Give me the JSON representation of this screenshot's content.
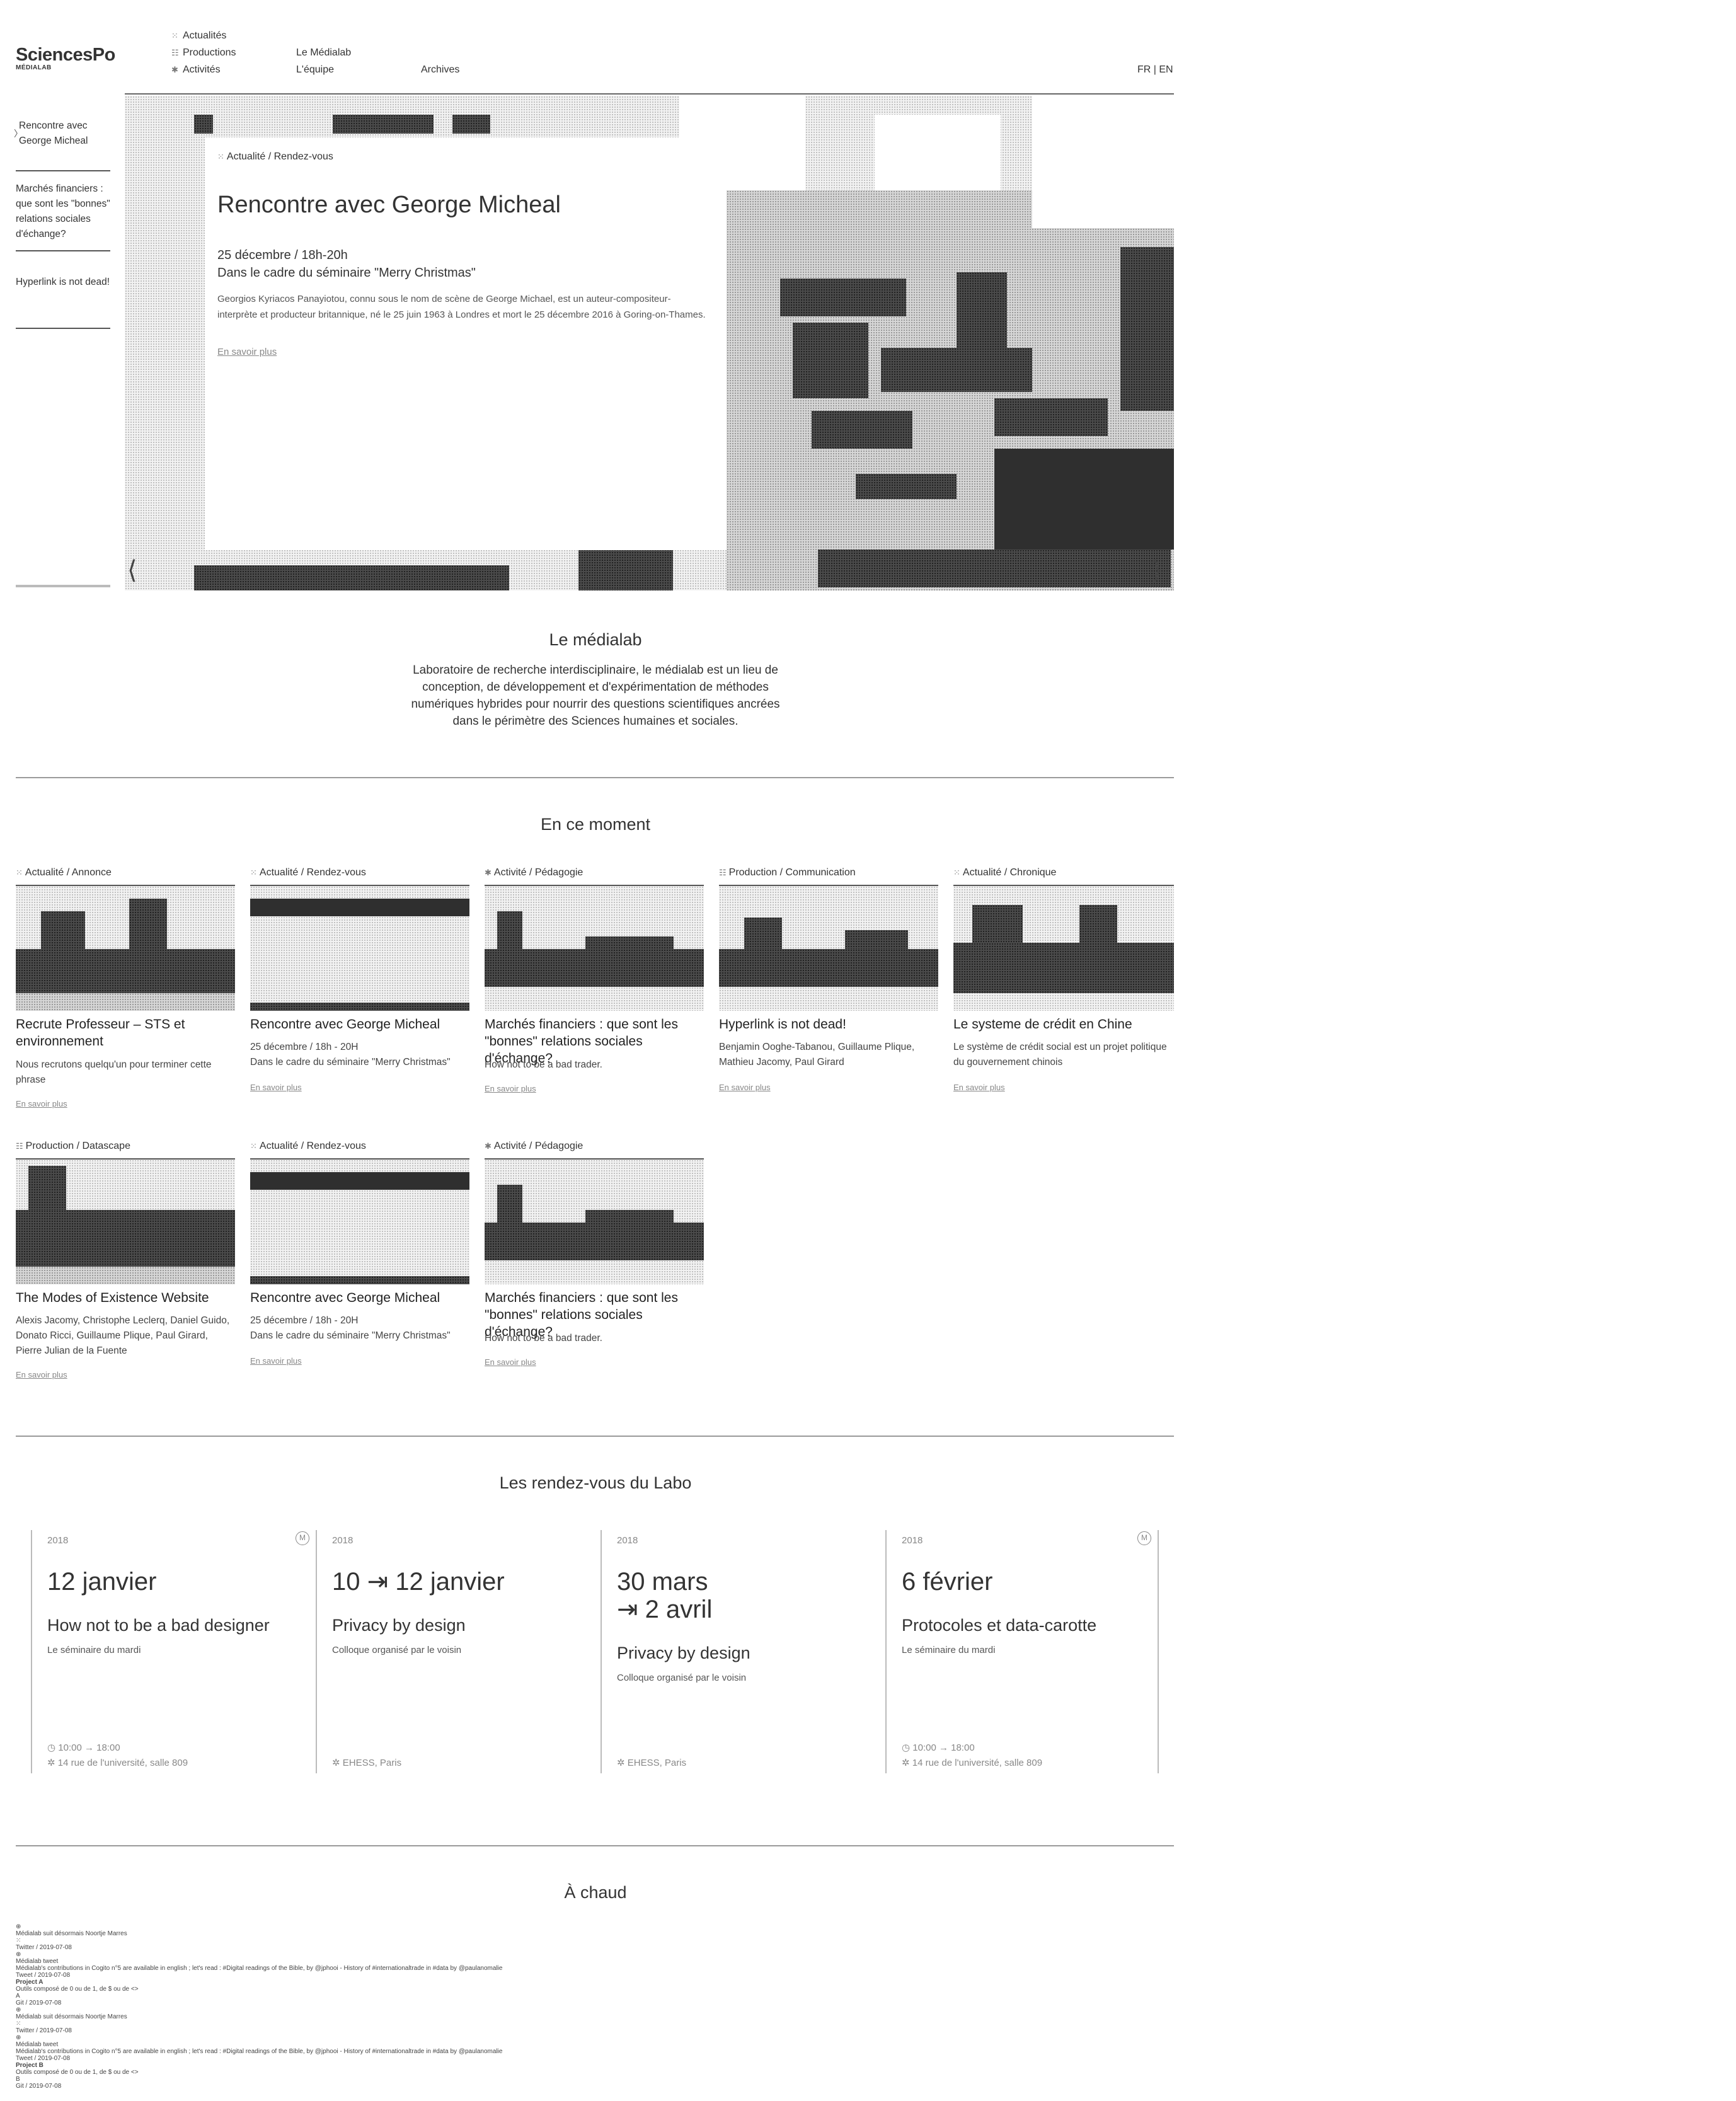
{
  "header": {
    "logo_name": "SciencesPo",
    "logo_sub": "MÉDIALAB",
    "nav": {
      "actualites": "Actualités",
      "productions": "Productions",
      "activites": "Activités",
      "medialab": "Le Médialab",
      "equipe": "L'équipe",
      "archives": "Archives"
    },
    "lang": "FR | EN"
  },
  "sidebar": {
    "items": [
      "Rencontre avec George Micheal",
      "Marchés financiers : que sont les \"bonnes\" relations sociales d'échange?",
      "Hyperlink is not dead!"
    ]
  },
  "hero": {
    "category": "Actualité / Rendez-vous",
    "title": "Rencontre avec George Micheal",
    "date": "25 décembre / 18h-20h",
    "context": "Dans le cadre du séminaire \"Merry Christmas\"",
    "description": "Georgios Kyriacos Panayiotou, connu sous le nom de scène de George Michael, est un auteur-compositeur-interprète et producteur britannique, né le 25 juin 1963 à Londres et mort le 25 décembre 2016 à Goring-on-Thames.",
    "more": "En savoir plus",
    "prev": "⟨",
    "next": "⟩"
  },
  "about": {
    "title": "Le médialab",
    "text": "Laboratoire de recherche interdisciplinaire, le médialab est un lieu de conception, de développement et d'expérimentation de méthodes numériques hybrides pour nourrir des questions scientifiques ancrées dans le périmètre des Sciences humaines et sociales."
  },
  "now": {
    "title": "En ce moment",
    "cards": [
      {
        "icon": "⁙",
        "tag": "Actualité / Annonce",
        "title": "Recrute Professeur – STS et environnement",
        "text": "Nous recrutons quelqu'un pour terminer cette phrase",
        "more": "En savoir plus"
      },
      {
        "icon": "⁙",
        "tag": "Actualité / Rendez-vous",
        "title": "Rencontre avec George Micheal",
        "text": "25 décembre / 18h - 20H\nDans le cadre du séminaire \"Merry Christmas\"",
        "more": "En savoir plus"
      },
      {
        "icon": "✱",
        "tag": "Activité / Pédagogie",
        "title": "Marchés financiers : que sont les \"bonnes\" relations sociales d'échange?",
        "text": "How not to be a bad trader.",
        "more": "En savoir plus"
      },
      {
        "icon": "☷",
        "tag": "Production / Communication",
        "title": "Hyperlink is not dead!",
        "text": "Benjamin Ooghe-Tabanou, Guillaume Plique, Mathieu Jacomy, Paul Girard",
        "more": "En savoir plus"
      },
      {
        "icon": "⁙",
        "tag": "Actualité / Chronique",
        "title": "Le systeme de crédit en Chine",
        "text": "Le système de crédit social est un projet politique du gouvernement chinois",
        "more": "En savoir plus"
      },
      {
        "icon": "☷",
        "tag": "Production / Datascape",
        "title": "The Modes of Existence Website",
        "text": "Alexis Jacomy, Christophe Leclerq, Daniel Guido, Donato Ricci, Guillaume Plique, Paul Girard, Pierre Julian de la Fuente",
        "more": "En savoir plus"
      },
      {
        "icon": "⁙",
        "tag": "Actualité / Rendez-vous",
        "title": "Rencontre avec George Micheal",
        "text": "25 décembre / 18h - 20H\nDans le cadre du séminaire \"Merry Christmas\"",
        "more": "En savoir plus"
      },
      {
        "icon": "✱",
        "tag": "Activité / Pédagogie",
        "title": "Marchés financiers : que sont les \"bonnes\" relations sociales d'échange?",
        "text": "How not to be a bad trader.",
        "more": "En savoir plus"
      }
    ]
  },
  "rdv": {
    "title": "Les rendez-vous du Labo",
    "items": [
      {
        "year": "2018",
        "badge": "M",
        "date": "12 janvier",
        "title": "How not to be a bad designer",
        "sub": "Le séminaire du mardi",
        "time": "◷ 10:00 → 18:00",
        "place": "✲ 14 rue de l'université, salle 809"
      },
      {
        "year": "2018",
        "badge": "",
        "date": "10 ⇥ 12 janvier",
        "title": "Privacy by design",
        "sub": "Colloque organisé par le voisin",
        "time": "",
        "place": "✲ EHESS, Paris"
      },
      {
        "year": "2018",
        "badge": "",
        "date": "30 mars\n⇥ 2 avril",
        "title": "Privacy by design",
        "sub": "Colloque organisé par le voisin",
        "time": "",
        "place": "✲ EHESS, Paris"
      },
      {
        "year": "2018",
        "badge": "M",
        "date": "6 février",
        "title": "Protocoles et data-carotte",
        "sub": "Le séminaire du mardi",
        "time": "◷ 10:00 → 18:00",
        "place": "✲ 14 rue de l'université, salle 809"
      }
    ]
  },
  "hot": {
    "title": "À chaud",
    "lines": [
      "⊕",
      "Médialab suit désormais Noortje Marres",
      "⁙",
      "Twitter / 2019-07-08",
      "⊕",
      "Médialab tweet",
      "Médialab's contributions in Cogito n°5 are available in english ; let's read : #Digital readings of the Bible, by @jphooi - History of #internationaltrade in #data by @paulanomalie",
      "Tweet / 2019-07-08",
      "Project A",
      "Outils composé de 0 ou de 1, de $ ou de <>",
      "A",
      "Git / 2019-07-08",
      "⊕",
      "Médialab suit désormais Noortje Marres",
      "⁙",
      "Twitter / 2019-07-08",
      "⊕",
      "Médialab tweet",
      "Médialab's contributions in Cogito n°5 are available in english ; let's read : #Digital readings of the Bible, by @jphooi - History of #internationaltrade in #data by @paulanomalie",
      "Tweet / 2019-07-08",
      "Project B",
      "Outils composé de 0 ou de 1, de $ ou de <>",
      "B",
      "Git / 2019-07-08"
    ]
  }
}
